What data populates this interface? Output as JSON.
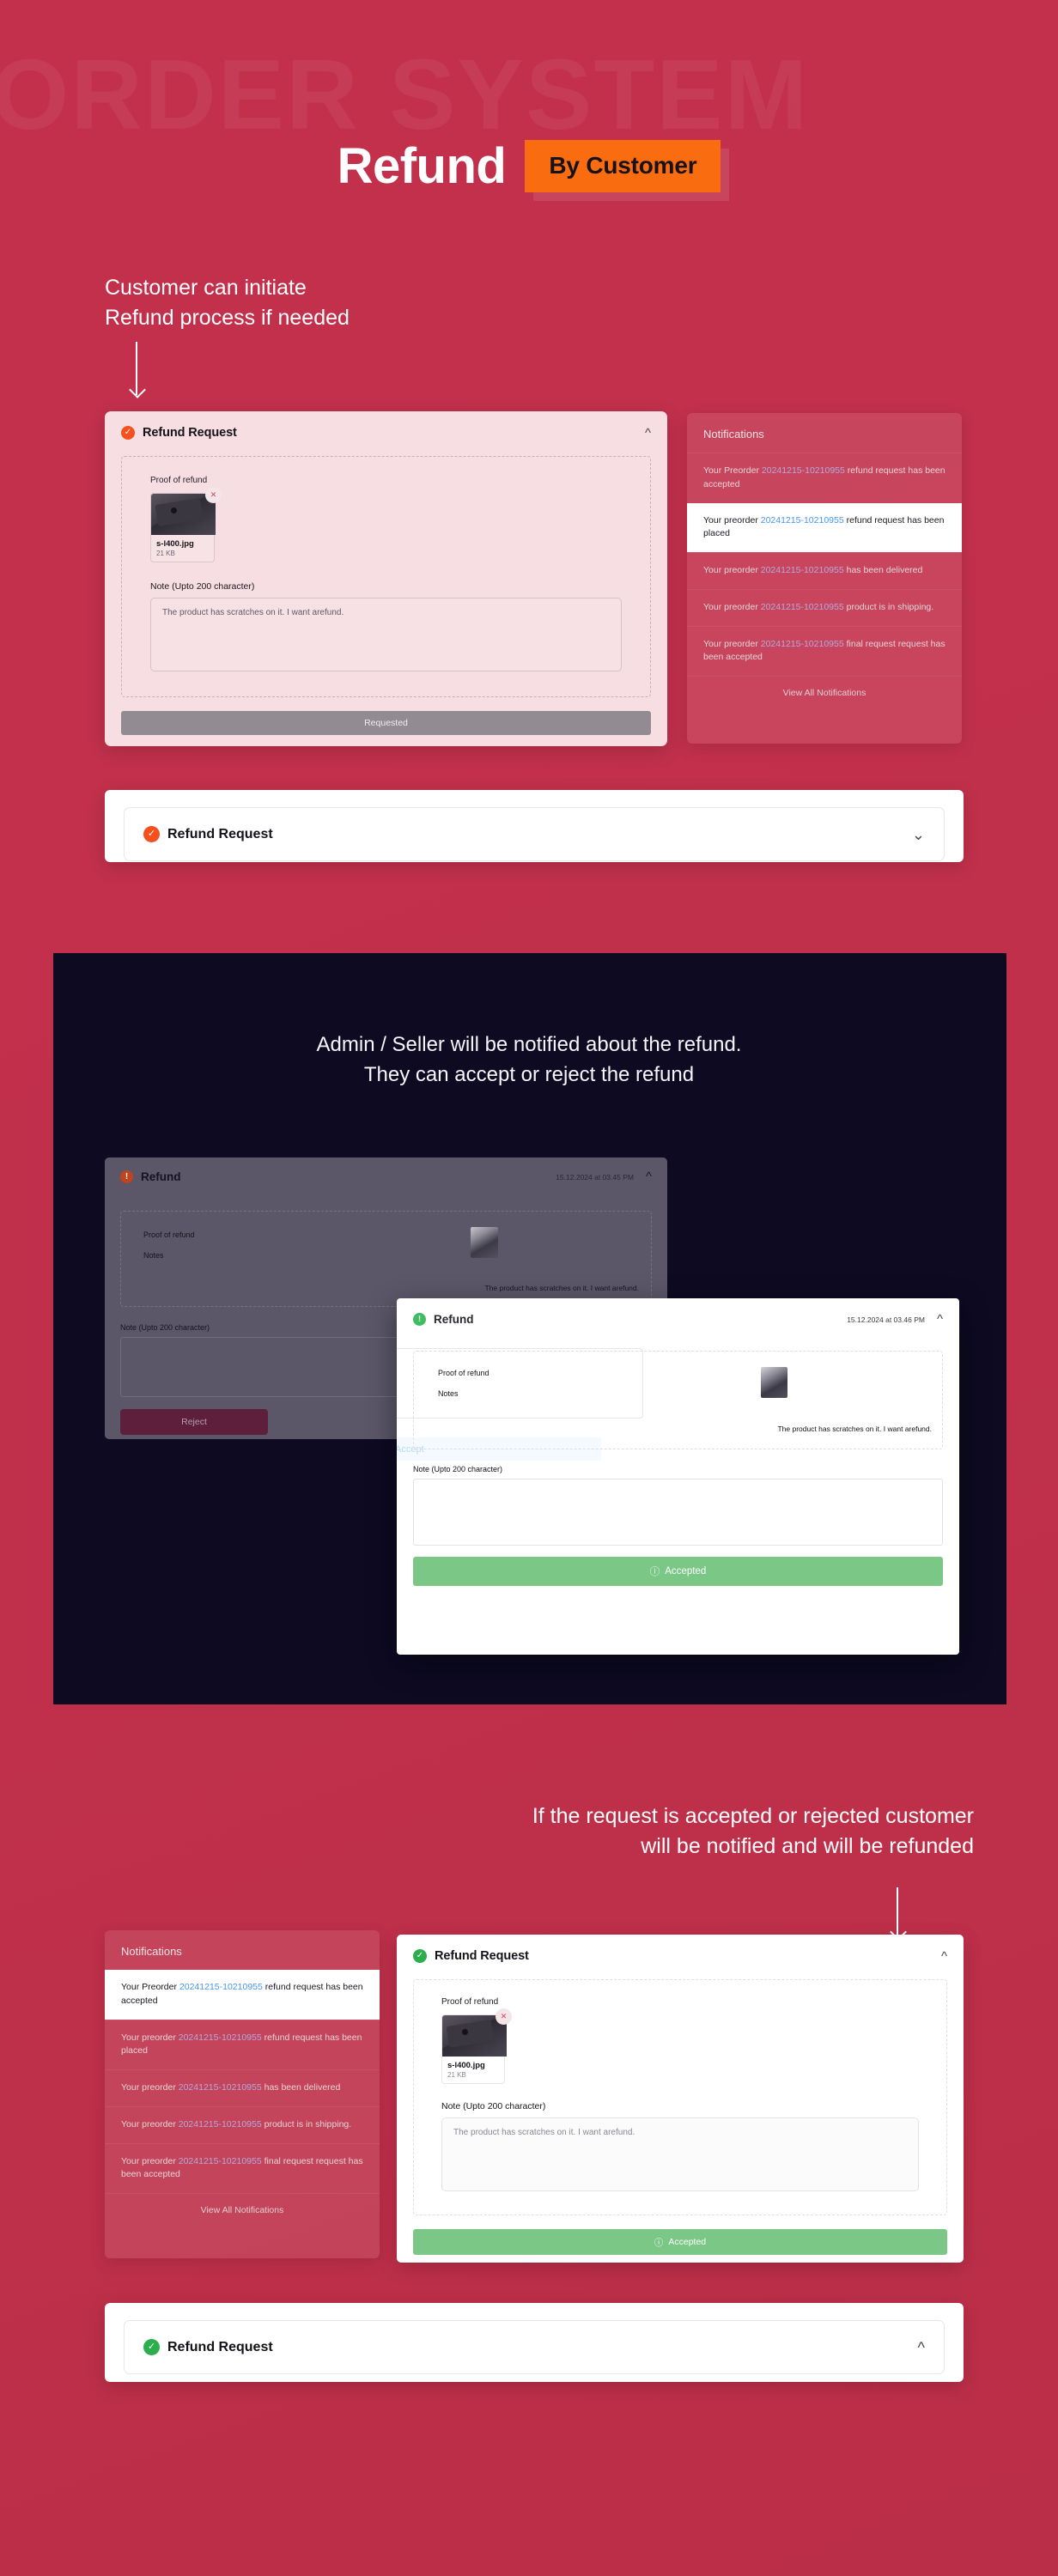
{
  "page": {
    "watermark": "ORDER SYSTEM",
    "bg_color": "#c1304b",
    "dark_band_color": "#0d0a22",
    "accent_orange": "#f96c10",
    "accent_green": "#7bc786"
  },
  "header": {
    "title": "Refund",
    "badge": "By Customer"
  },
  "captions": {
    "step1": "Customer can initiate Refund process if needed",
    "step2_line1": "Admin / Seller will be notified about the refund.",
    "step2_line2": "They can accept or reject the refund",
    "step3_line1": "If the request is accepted or rejected customer",
    "step3_line2": "will be notified and will be refunded"
  },
  "refund_card_customer": {
    "title": "Refund Request",
    "status_icon": "check-circle-orange-icon",
    "chevron": "chevron-up-icon",
    "proof_label": "Proof of refund",
    "file": {
      "name": "s-l400.jpg",
      "size": "21 KB",
      "remove_icon": "close-x-icon"
    },
    "note_label": "Note  (Upto 200 character)",
    "note_value": "The product has scratches on it. I want arefund.",
    "action_button": "Requested"
  },
  "notifications_panel_1": {
    "title": "Notifications",
    "order_id": "20241215-10210955",
    "items": [
      {
        "prefix": "Your Preorder ",
        "oid": "20241215-10210955",
        "suffix": " refund request has been accepted",
        "active": false
      },
      {
        "prefix": "Your preorder ",
        "oid": "20241215-10210955",
        "suffix": " refund request has been placed",
        "active": true
      },
      {
        "prefix": "Your preorder ",
        "oid": "20241215-10210955",
        "suffix": " has been delivered",
        "active": false
      },
      {
        "prefix": "Your preorder ",
        "oid": "20241215-10210955",
        "suffix": " product is in shipping.",
        "active": false
      },
      {
        "prefix": "Your preorder ",
        "oid": "20241215-10210955",
        "suffix": " final request request has been accepted",
        "active": false
      }
    ],
    "footer": "View All Notifications"
  },
  "collapsed_card_1": {
    "title": "Refund Request",
    "status_icon": "check-circle-orange-icon",
    "chevron": "chevron-down-icon"
  },
  "admin_back_card": {
    "title": "Refund",
    "status_icon": "info-circle-orange-icon",
    "timestamp": "15.12.2024 at 03.45 PM",
    "chevron": "chevron-up-icon",
    "proof_label": "Proof of refund",
    "notes_label": "Notes",
    "note_text": "The product has scratches on it. I want arefund.",
    "note_label": "Note  (Upto 200 character)",
    "reject_button": "Reject"
  },
  "admin_front_card": {
    "title": "Refund",
    "status_icon": "info-circle-green-icon",
    "timestamp": "15.12.2024 at 03.46 PM",
    "chevron": "chevron-up-icon",
    "accept_label": "Accept",
    "proof_label": "Proof of refund",
    "notes_label": "Notes",
    "note_text": "The product has scratches on it. I want arefund.",
    "note_label": "Note  (Upto 200 character)",
    "accepted_button": "Accepted",
    "accepted_icon": "check-circle-outline-icon"
  },
  "notifications_panel_2": {
    "title": "Notifications",
    "items": [
      {
        "prefix": "Your Preorder ",
        "oid": "20241215-10210955",
        "suffix": " refund request has been accepted",
        "active": true
      },
      {
        "prefix": "Your preorder ",
        "oid": "20241215-10210955",
        "suffix": " refund request has been placed",
        "active": false
      },
      {
        "prefix": "Your preorder ",
        "oid": "20241215-10210955",
        "suffix": " has been delivered",
        "active": false
      },
      {
        "prefix": "Your preorder ",
        "oid": "20241215-10210955",
        "suffix": " product is in shipping.",
        "active": false
      },
      {
        "prefix": "Your preorder ",
        "oid": "20241215-10210955",
        "suffix": " final request request has been accepted",
        "active": false
      }
    ],
    "footer": "View All Notifications"
  },
  "refund_card_accepted": {
    "title": "Refund Request",
    "status_icon": "check-circle-green-icon",
    "chevron": "chevron-up-icon",
    "proof_label": "Proof of refund",
    "file": {
      "name": "s-l400.jpg",
      "size": "21 KB",
      "remove_icon": "close-x-icon"
    },
    "note_label": "Note  (Upto 200 character)",
    "note_value": "The product has scratches on it. I want arefund.",
    "action_button": "Accepted",
    "action_icon": "check-circle-outline-icon"
  },
  "collapsed_card_2": {
    "title": "Refund Request",
    "status_icon": "check-circle-green-icon",
    "chevron": "chevron-up-icon"
  }
}
